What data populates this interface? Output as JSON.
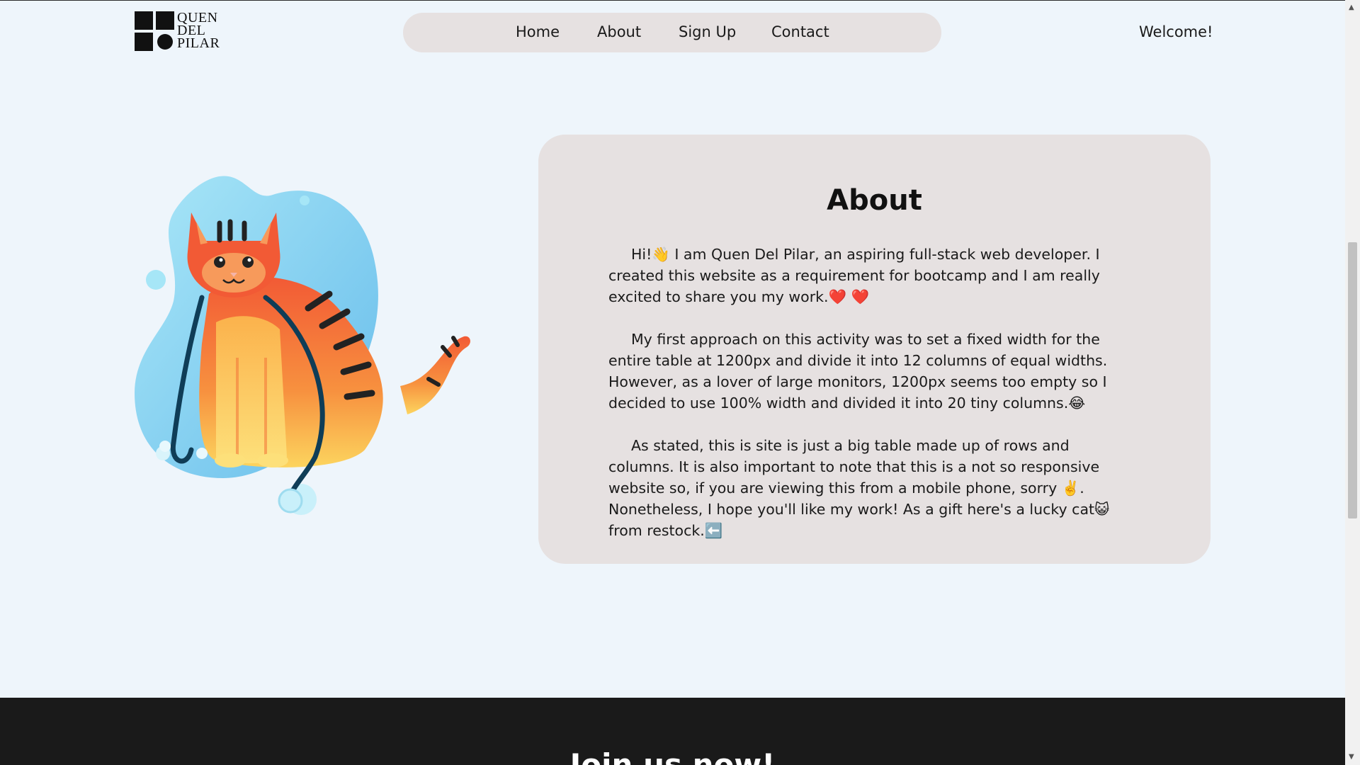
{
  "header": {
    "logo": {
      "line1": "QUEN",
      "line2": "DEL",
      "line3": "PILAR"
    },
    "nav": [
      {
        "label": "Home"
      },
      {
        "label": "About"
      },
      {
        "label": "Sign Up"
      },
      {
        "label": "Contact"
      }
    ],
    "welcome": "Welcome!"
  },
  "about": {
    "title": "About",
    "paragraphs": [
      "Hi!👋 I am Quen Del Pilar, an aspiring full-stack web developer. I created this website as a requirement for bootcamp and I am really excited to share you my work.❤️ ❤️",
      "My first approach on this activity was to set a fixed width for the entire table at 1200px and divide it into 12 columns of equal widths. However, as a lover of large monitors, 1200px seems too empty so I decided to use 100% width and divided it into 20 tiny columns.😂",
      "As stated, this is site is just a big table made up of rows and columns. It is also important to note that this is a not so responsive website so, if you are viewing this from a mobile phone, sorry ✌️. Nonetheless, I hope you'll like my work! As a gift here's a lucky cat😺 from restock.⬅️"
    ]
  },
  "illustration": {
    "icon": "cat-with-stethoscope"
  },
  "footer": {
    "heading": "Join us now!"
  },
  "colors": {
    "background": "#eef5fb",
    "card": "#e6e1e1",
    "footer": "#1a1a1a",
    "cat_orange": "#f26b3a",
    "blob_blue": "#7fd3f0"
  }
}
